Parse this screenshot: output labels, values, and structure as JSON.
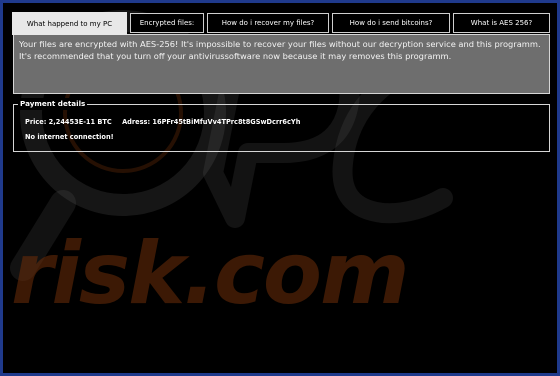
{
  "tabs": [
    {
      "label": "What happend to my PC",
      "active": true
    },
    {
      "label": "Encrypted files:",
      "active": false
    },
    {
      "label": "How do i recover my files?",
      "active": false
    },
    {
      "label": "How do i send bitcoins?",
      "active": false
    },
    {
      "label": "What is AES 256?",
      "active": false
    }
  ],
  "message": {
    "text": "Your files are encrypted with AES-256! It's impossible to recover your files without our decryption service and this programm. It's recommended that you turn off your antivirussoftware now because it may removes this programm."
  },
  "payment": {
    "title": "Payment details",
    "price_label": "Price: 2,24453E-11 BTC",
    "address_label": "Adress: 16PFr45tBiMfuVv4TPrc8t8GSwDcrr6cYh",
    "status": "No internet connection!"
  },
  "watermark": {
    "text": "risk.com"
  },
  "colors": {
    "background": "#000000",
    "window_border": "#1f3a8c",
    "panel_gray": "#6e6e6e",
    "active_tab": "#e8e8e8",
    "watermark": "#6e2d0a"
  }
}
